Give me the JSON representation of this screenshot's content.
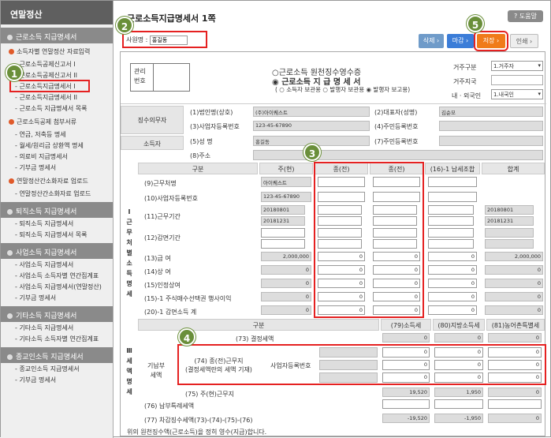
{
  "sidebar": {
    "title": "연말정산",
    "sec1": "근로소득 지급명세서",
    "grp1": "소득자별 연말정산 자료입력",
    "items1": [
      "근로소득공제신고서 I",
      "근로소득공제신고서 II",
      "근로소득지급명세서 I",
      "근로소득지급명세서 II",
      "근로소득 지급명세서 목록"
    ],
    "grp2": "근로소득공제 첨부서류",
    "items2": [
      "연금, 저축등 명세",
      "월세/원리금 상환액 명세",
      "의료비 지급명세서",
      "기부금 명세서"
    ],
    "grp3": "연말정산간소화자료 업로드",
    "items3": [
      "연말정산간소화자료 업로드"
    ],
    "sec2": "퇴직소득 지급명세서",
    "items4": [
      "퇴직소득 지급명세서",
      "퇴직소득 지급명세서 목록"
    ],
    "sec3": "사업소득 지급명세서",
    "items5": [
      "사업소득 지급명세서",
      "사업소득 소득자별 연간집계표",
      "사업소득 지급명세서(연말정산)",
      "기부금 명세서"
    ],
    "sec4": "기타소득 지급명세서",
    "items6": [
      "기타소득 지급명세서",
      "기타소득 소득자별 연간집계표"
    ],
    "sec5": "종교인소득 지급명세서",
    "items7": [
      "종교인소득 지급명세서",
      "기부금 명세서"
    ]
  },
  "badges": {
    "b1": "1",
    "b2": "2",
    "b3": "3",
    "b4": "4",
    "b5": "5"
  },
  "header": {
    "title": "근로소득지급명세서 1쪽",
    "help": "도움말",
    "emp_label": "사원명 :",
    "emp_value": "홍길동",
    "btn_delete": "삭제",
    "btn_close": "마감",
    "btn_save": "저장",
    "btn_print": "인쇄"
  },
  "form": {
    "mgmt": "관리\n번호",
    "t1": "○근로소득 원천징수영수증",
    "t2": "◉ 근로소득 지 급 명 세 서",
    "t3": "( ○ 소득자 보관용 ○ 발행자 보관용 ◉ 발행자 보고용)",
    "res_label": "거주구분",
    "res_value": "1.거주자",
    "country_label": "거주지국",
    "nat_label": "내 · 외국인",
    "nat_value": "1.내국인",
    "withholder": "징수의무자",
    "f1": "(1)법인명(상호)",
    "f1v": "(주)아이퀘스트",
    "f2": "(2)대표자(성명)",
    "f2v": "김순모",
    "f3": "(3)사업자등록번호",
    "f3v": "123-45-67890",
    "f4": "(4)주민등록번호",
    "earner": "소득자",
    "f5": "(5)성 명",
    "f5v": "홍길동",
    "f7": "(7)주민등록번호",
    "f8": "(8)주소",
    "col_gubun": "구분",
    "col_main": "주(현)",
    "col_prev1": "종(전)",
    "col_prev2": "종(전)",
    "col_union": "(16)-1 납세조합",
    "col_total": "합계",
    "sec_work": "Ⅰ\n근\n무\n처\n별\n소\n득\n명\n세",
    "r9": "(9)근무처명",
    "r9v": "아이퀘스트",
    "r10": "(10)사업자등록번호",
    "r10v": "123-45-67890",
    "r11": "(11)근무기간",
    "r11a": "20180801",
    "r11b": "20181231",
    "r12": "(12)감면기간",
    "r13": "(13)급 여",
    "r13v": "2,000,000",
    "r14": "(14)상 여",
    "r15": "(15)인정상여",
    "r15_1": "(15)-1 주식매수선택권 행사이익",
    "r20_1": "(20)-1 감면소득 계",
    "zero": "0",
    "tax_gubun": "구분",
    "tax_c79": "(79)소득세",
    "tax_c80": "(80)지방소득세",
    "tax_c81": "(81)농어촌특별세",
    "sec_tax": "Ⅲ\n세\n액\n명\n세",
    "r73": "(73) 결정세액",
    "paid": "기납부\n세액",
    "r74": "(74) 종(전)근무지\n(결정세액란의 세액 기재)",
    "bizno": "사업자등록번호",
    "r75": "(75) 주(현)근무지",
    "r75a": "19,520",
    "r75b": "1,950",
    "r76": "(76) 납부특례세액",
    "r77": "(77) 차감징수세액(73)-(74)-(75)-(76)",
    "r77a": "-19,520",
    "r77b": "-1,950",
    "footer": "위의 원천징수액(근로소득)을 정히 영수(지급)합니다."
  }
}
